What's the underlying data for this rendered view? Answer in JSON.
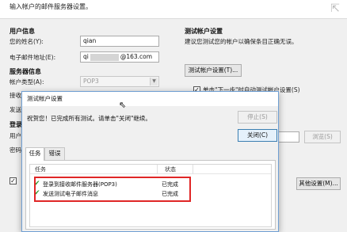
{
  "header": {
    "text": "输入帐户的邮件服务器设置。",
    "icon": "cursor-arrow-icon"
  },
  "user_info": {
    "title": "用户信息",
    "name_label": "您的姓名(Y):",
    "name_value": "qian",
    "email_label": "电子邮件地址(E):",
    "email_prefix": "qi",
    "email_suffix": "@163.com"
  },
  "server_info": {
    "title": "服务器信息",
    "account_type_label": "帐户类型(A):",
    "account_type_value": "POP3",
    "incoming_label_partial": "接收",
    "outgoing_label_partial": "发送"
  },
  "logon_partial": {
    "title": "登录",
    "user_partial": "用户",
    "pwd_partial": "密码"
  },
  "test_settings": {
    "title": "测试帐户设置",
    "desc": "建议您测试您的帐户以确保条目正确无误。",
    "test_button": "测试帐户设置(T)...",
    "auto_test_checkbox": "单击\"下一步\"时自动测试帐户设置(S)",
    "browse_button": "浏览(S)",
    "more_settings_button": "其他设置(M)..."
  },
  "dialog": {
    "title": "测试帐户设置",
    "message": "祝贺您！已完成所有测试。请单击\"关闭\"继续。",
    "stop_button": "停止(S)",
    "close_button": "关闭(C)",
    "tabs": [
      {
        "label": "任务"
      },
      {
        "label": "错误"
      }
    ],
    "columns": {
      "task": "任务",
      "status": "状态"
    },
    "rows": [
      {
        "task": "登录到接收邮件服务器(POP3)",
        "status": "已完成"
      },
      {
        "task": "发送测试电子邮件消息",
        "status": "已完成"
      }
    ]
  }
}
